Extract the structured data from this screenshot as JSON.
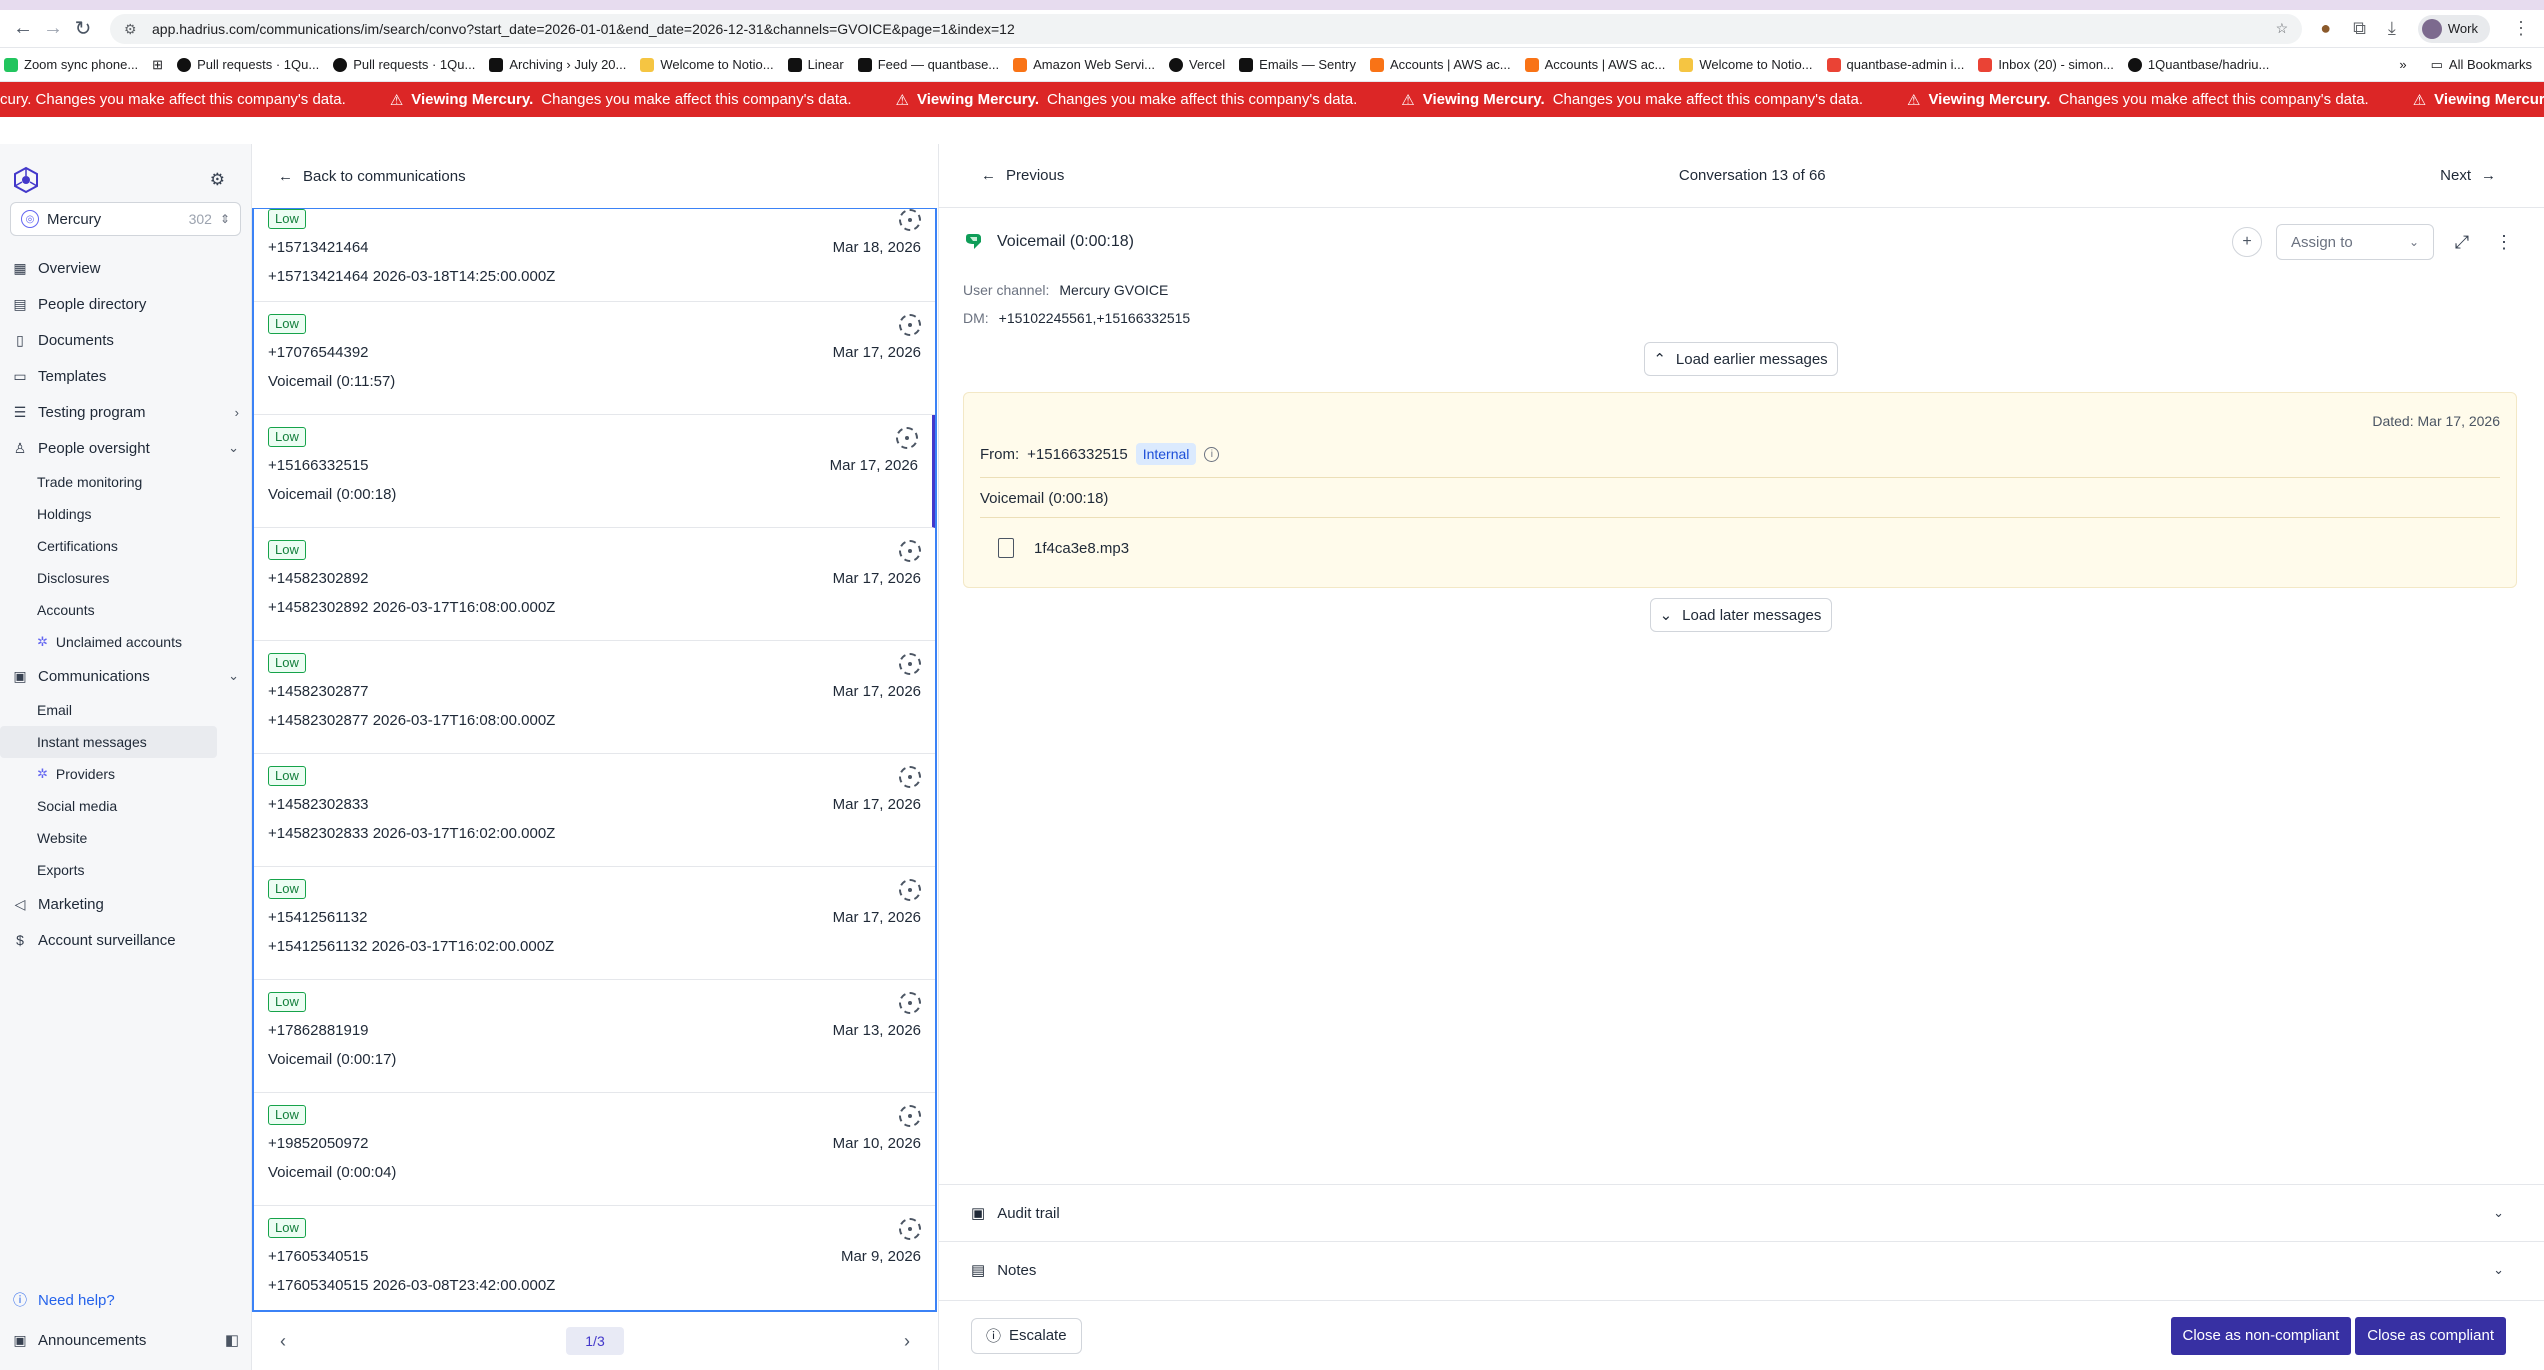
{
  "browser": {
    "url": "app.hadrius.com/communications/im/search/convo?start_date=2026-01-01&end_date=2026-12-31&channels=GVOICE&page=1&index=12",
    "profile": "Work",
    "bookmarks": [
      "Zoom sync phone...",
      "Pull requests · 1Qu...",
      "Pull requests · 1Qu...",
      "Archiving › July 20...",
      "Welcome to Notio...",
      "Linear",
      "Feed — quantbase...",
      "Amazon Web Servi...",
      "Vercel",
      "Emails — Sentry",
      "Accounts | AWS ac...",
      "Accounts | AWS ac...",
      "Welcome to Notio...",
      "quantbase-admin i...",
      "Inbox (20) - simon...",
      "1Quantbase/hadriu..."
    ],
    "all_bookmarks": "All Bookmarks"
  },
  "banner": {
    "partial_start": "cury. Changes you make affect this company's data.",
    "bold": "Viewing Mercury.",
    "rest": "Changes you make affect this company's data.",
    "partial_end": "Viewing Mercury. Ch"
  },
  "sidebar": {
    "org": {
      "name": "Mercury",
      "count": "302"
    },
    "nav": {
      "overview": "Overview",
      "people_directory": "People directory",
      "documents": "Documents",
      "templates": "Templates",
      "testing_program": "Testing program",
      "people_oversight": "People oversight",
      "trade_monitoring": "Trade monitoring",
      "holdings": "Holdings",
      "certifications": "Certifications",
      "disclosures": "Disclosures",
      "accounts": "Accounts",
      "unclaimed_accounts": "Unclaimed accounts",
      "communications": "Communications",
      "email": "Email",
      "instant_messages": "Instant messages",
      "providers": "Providers",
      "social_media": "Social media",
      "website": "Website",
      "exports": "Exports",
      "marketing": "Marketing",
      "account_surveillance": "Account surveillance"
    },
    "help": "Need help?",
    "announcements": "Announcements"
  },
  "list": {
    "back": "Back to communications",
    "rows": [
      {
        "badge": "Low",
        "phone": "+15713421464",
        "date": "Mar 18, 2026",
        "preview": "+15713421464 2026-03-18T14:25:00.000Z"
      },
      {
        "badge": "Low",
        "phone": "+17076544392",
        "date": "Mar 17, 2026",
        "preview": "Voicemail (0:11:57)"
      },
      {
        "badge": "Low",
        "phone": "+15166332515",
        "date": "Mar 17, 2026",
        "preview": "Voicemail (0:00:18)"
      },
      {
        "badge": "Low",
        "phone": "+14582302892",
        "date": "Mar 17, 2026",
        "preview": "+14582302892 2026-03-17T16:08:00.000Z"
      },
      {
        "badge": "Low",
        "phone": "+14582302877",
        "date": "Mar 17, 2026",
        "preview": "+14582302877 2026-03-17T16:08:00.000Z"
      },
      {
        "badge": "Low",
        "phone": "+14582302833",
        "date": "Mar 17, 2026",
        "preview": "+14582302833 2026-03-17T16:02:00.000Z"
      },
      {
        "badge": "Low",
        "phone": "+15412561132",
        "date": "Mar 17, 2026",
        "preview": "+15412561132 2026-03-17T16:02:00.000Z"
      },
      {
        "badge": "Low",
        "phone": "+17862881919",
        "date": "Mar 13, 2026",
        "preview": "Voicemail (0:00:17)"
      },
      {
        "badge": "Low",
        "phone": "+19852050972",
        "date": "Mar 10, 2026",
        "preview": "Voicemail (0:00:04)"
      },
      {
        "badge": "Low",
        "phone": "+17605340515",
        "date": "Mar 9, 2026",
        "preview": "+17605340515 2026-03-08T23:42:00.000Z"
      }
    ],
    "page": "1/3"
  },
  "detail": {
    "previous": "Previous",
    "position": "Conversation 13 of 66",
    "next": "Next",
    "title": "Voicemail (0:00:18)",
    "assign_placeholder": "Assign to",
    "user_channel_label": "User channel:",
    "user_channel": "Mercury GVOICE",
    "dm_label": "DM:",
    "dm": "+15102245561,+15166332515",
    "load_earlier": "Load earlier messages",
    "message": {
      "dated": "Dated: Mar 17, 2026",
      "from_label": "From:",
      "from": "+15166332515",
      "tag": "Internal",
      "body": "Voicemail (0:00:18)",
      "attachment": "1f4ca3e8.mp3"
    },
    "load_later": "Load later messages",
    "audit_trail": "Audit trail",
    "notes": "Notes",
    "escalate": "Escalate",
    "close_noncompliant": "Close as non-compliant",
    "close_compliant": "Close as compliant"
  }
}
